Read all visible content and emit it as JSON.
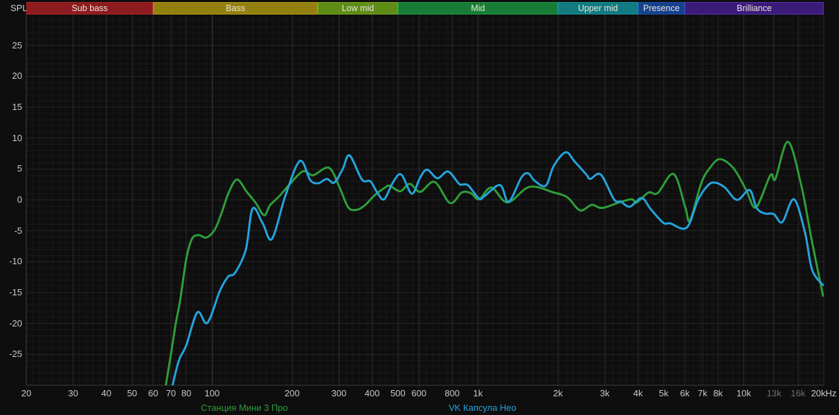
{
  "app": {
    "spl_label": "SPL"
  },
  "colors": {
    "background": "#0e0e0e",
    "grid_minor": "#181818",
    "grid_major": "#262626",
    "grid_tick": "#2a2a2a",
    "grid_decade": "#343434",
    "axis_line": "#3f3f3f",
    "tick_text": "#c9c9c9",
    "tick_text_dim": "#6f6f6f",
    "band_text": "#e9e6da",
    "series_green": "#2e9e3a",
    "series_blue": "#25a3de"
  },
  "bands": [
    {
      "id": "sub-bass",
      "label": "Sub bass",
      "f_start": 20,
      "f_end": 60,
      "fill": "#8e1b1f",
      "border": "#b0272c"
    },
    {
      "id": "bass",
      "label": "Bass",
      "f_start": 60,
      "f_end": 250,
      "fill": "#93800f",
      "border": "#b49c15"
    },
    {
      "id": "low-mid",
      "label": "Low mid",
      "f_start": 250,
      "f_end": 500,
      "fill": "#5e8c17",
      "border": "#77a91f"
    },
    {
      "id": "mid",
      "label": "Mid",
      "f_start": 500,
      "f_end": 2000,
      "fill": "#177d36",
      "border": "#1f9c44"
    },
    {
      "id": "upper-mid",
      "label": "Upper mid",
      "f_start": 2000,
      "f_end": 4000,
      "fill": "#127a80",
      "border": "#17969e"
    },
    {
      "id": "presence",
      "label": "Presence",
      "f_start": 4000,
      "f_end": 6000,
      "fill": "#16418c",
      "border": "#1d53b0"
    },
    {
      "id": "brilliance",
      "label": "Brilliance",
      "f_start": 6000,
      "f_end": 20000,
      "fill": "#3a1b7a",
      "border": "#5c32b4"
    }
  ],
  "x_axis": {
    "ticks": [
      {
        "label": "20",
        "f": 20
      },
      {
        "label": "30",
        "f": 30
      },
      {
        "label": "40",
        "f": 40
      },
      {
        "label": "50",
        "f": 50
      },
      {
        "label": "60",
        "f": 60
      },
      {
        "label": "70",
        "f": 70
      },
      {
        "label": "80",
        "f": 80
      },
      {
        "label": "100",
        "f": 100
      },
      {
        "label": "200",
        "f": 200
      },
      {
        "label": "300",
        "f": 300
      },
      {
        "label": "400",
        "f": 400
      },
      {
        "label": "500",
        "f": 500
      },
      {
        "label": "600",
        "f": 600
      },
      {
        "label": "800",
        "f": 800
      },
      {
        "label": "1k",
        "f": 1000
      },
      {
        "label": "2k",
        "f": 2000
      },
      {
        "label": "3k",
        "f": 3000
      },
      {
        "label": "4k",
        "f": 4000
      },
      {
        "label": "5k",
        "f": 5000
      },
      {
        "label": "6k",
        "f": 6000
      },
      {
        "label": "7k",
        "f": 7000
      },
      {
        "label": "8k",
        "f": 8000
      },
      {
        "label": "10k",
        "f": 10000
      },
      {
        "label": "13k",
        "f": 13000,
        "dim": true
      },
      {
        "label": "16k",
        "f": 16000,
        "dim": true
      },
      {
        "label": "20kHz",
        "f": 20000
      }
    ]
  },
  "y_axis": {
    "unit": "dB SPL",
    "min": -30,
    "max": 30,
    "ticks": [
      {
        "label": "25",
        "value": 25
      },
      {
        "label": "20",
        "value": 20
      },
      {
        "label": "15",
        "value": 15
      },
      {
        "label": "10",
        "value": 10
      },
      {
        "label": "5",
        "value": 5
      },
      {
        "label": "0",
        "value": 0
      },
      {
        "label": "-5",
        "value": -5
      },
      {
        "label": "-10",
        "value": -10
      },
      {
        "label": "-15",
        "value": -15
      },
      {
        "label": "-20",
        "value": -20
      },
      {
        "label": "-25",
        "value": -25
      }
    ]
  },
  "legend": [
    {
      "id": "stantsiya-mini-3-pro",
      "label": "Станция Мини 3 Про",
      "color": "#2e9e3a"
    },
    {
      "id": "vk-kapsula-neo",
      "label": "VK Капсула Нео",
      "color": "#25a3de"
    }
  ],
  "chart_data": {
    "type": "line",
    "x_scale": "log",
    "x_unit": "Hz",
    "y_unit": "dB (SPL)",
    "xlim": [
      20,
      20000
    ],
    "ylim": [
      -30,
      30
    ],
    "grid": true,
    "legend_position": "bottom",
    "series": [
      {
        "name": "Станция Мини 3 Про",
        "color": "#2e9e3a",
        "points": [
          [
            67,
            -30
          ],
          [
            70,
            -25
          ],
          [
            73,
            -20
          ],
          [
            76,
            -16
          ],
          [
            80,
            -9.5
          ],
          [
            84,
            -6.3
          ],
          [
            89,
            -5.7
          ],
          [
            95,
            -6.1
          ],
          [
            102,
            -4.9
          ],
          [
            108,
            -2.4
          ],
          [
            115,
            1.0
          ],
          [
            124,
            3.3
          ],
          [
            135,
            1.3
          ],
          [
            146,
            -0.5
          ],
          [
            157,
            -2.5
          ],
          [
            165,
            -0.9
          ],
          [
            179,
            0.6
          ],
          [
            192,
            2.1
          ],
          [
            219,
            4.6
          ],
          [
            240,
            4.0
          ],
          [
            275,
            5.2
          ],
          [
            301,
            2.1
          ],
          [
            325,
            -1.2
          ],
          [
            350,
            -1.6
          ],
          [
            375,
            -0.9
          ],
          [
            410,
            0.8
          ],
          [
            444,
            1.9
          ],
          [
            465,
            2.3
          ],
          [
            510,
            1.4
          ],
          [
            554,
            2.6
          ],
          [
            606,
            1.3
          ],
          [
            687,
            2.9
          ],
          [
            785,
            -0.5
          ],
          [
            869,
            1.2
          ],
          [
            940,
            1.1
          ],
          [
            1010,
            0.1
          ],
          [
            1124,
            2.0
          ],
          [
            1292,
            -0.4
          ],
          [
            1564,
            2.1
          ],
          [
            1928,
            1.2
          ],
          [
            2172,
            0.4
          ],
          [
            2421,
            -1.7
          ],
          [
            2680,
            -0.8
          ],
          [
            2937,
            -1.3
          ],
          [
            3452,
            -0.3
          ],
          [
            3800,
            0.1
          ],
          [
            3960,
            -0.4
          ],
          [
            4386,
            1.2
          ],
          [
            4743,
            1.1
          ],
          [
            5445,
            4.2
          ],
          [
            6026,
            -1.2
          ],
          [
            6280,
            -3.3
          ],
          [
            6920,
            2.7
          ],
          [
            7440,
            5.1
          ],
          [
            8128,
            6.6
          ],
          [
            9160,
            5.1
          ],
          [
            10210,
            1.6
          ],
          [
            11118,
            -1.2
          ],
          [
            12596,
            4.0
          ],
          [
            13152,
            3.4
          ],
          [
            14656,
            9.4
          ],
          [
            16408,
            2.6
          ],
          [
            18072,
            -6.8
          ],
          [
            19868,
            -15.5
          ]
        ]
      },
      {
        "name": "VK Капсула Нео",
        "color": "#25a3de",
        "points": [
          [
            71,
            -30
          ],
          [
            75,
            -26
          ],
          [
            80,
            -23.5
          ],
          [
            88,
            -18.2
          ],
          [
            96,
            -19.9
          ],
          [
            107,
            -14.7
          ],
          [
            115,
            -12.4
          ],
          [
            122,
            -11.8
          ],
          [
            134,
            -8.0
          ],
          [
            142,
            -1.4
          ],
          [
            155,
            -3.8
          ],
          [
            168,
            -6.3
          ],
          [
            189,
            0.8
          ],
          [
            214,
            6.3
          ],
          [
            234,
            3.2
          ],
          [
            251,
            2.7
          ],
          [
            270,
            3.4
          ],
          [
            288,
            2.8
          ],
          [
            310,
            5.0
          ],
          [
            329,
            7.2
          ],
          [
            366,
            3.3
          ],
          [
            394,
            3.0
          ],
          [
            418,
            1.2
          ],
          [
            444,
            0.1
          ],
          [
            480,
            2.9
          ],
          [
            515,
            4.1
          ],
          [
            564,
            1.0
          ],
          [
            606,
            3.6
          ],
          [
            644,
            4.9
          ],
          [
            704,
            3.5
          ],
          [
            772,
            4.6
          ],
          [
            849,
            2.6
          ],
          [
            880,
            2.5
          ],
          [
            922,
            2.3
          ],
          [
            1010,
            0.2
          ],
          [
            1058,
            0.6
          ],
          [
            1211,
            2.4
          ],
          [
            1305,
            -0.3
          ],
          [
            1456,
            3.6
          ],
          [
            1546,
            4.3
          ],
          [
            1634,
            3.1
          ],
          [
            1800,
            2.3
          ],
          [
            1928,
            5.5
          ],
          [
            2140,
            7.7
          ],
          [
            2312,
            6.2
          ],
          [
            2558,
            4.1
          ],
          [
            2648,
            3.4
          ],
          [
            2898,
            4.1
          ],
          [
            3250,
            0.1
          ],
          [
            3452,
            -0.3
          ],
          [
            3730,
            -1.1
          ],
          [
            4132,
            0.3
          ],
          [
            4468,
            -1.5
          ],
          [
            4978,
            -3.7
          ],
          [
            5284,
            -3.8
          ],
          [
            6096,
            -4.5
          ],
          [
            6714,
            -0.1
          ],
          [
            7312,
            2.3
          ],
          [
            7800,
            2.8
          ],
          [
            8492,
            2.0
          ],
          [
            9440,
            0.0
          ],
          [
            10520,
            1.6
          ],
          [
            11172,
            -1.3
          ],
          [
            12000,
            -2.2
          ],
          [
            12968,
            -2.3
          ],
          [
            13960,
            -3.6
          ],
          [
            15452,
            0.1
          ],
          [
            17020,
            -5.4
          ],
          [
            18072,
            -11.3
          ],
          [
            19868,
            -13.8
          ]
        ]
      }
    ]
  }
}
